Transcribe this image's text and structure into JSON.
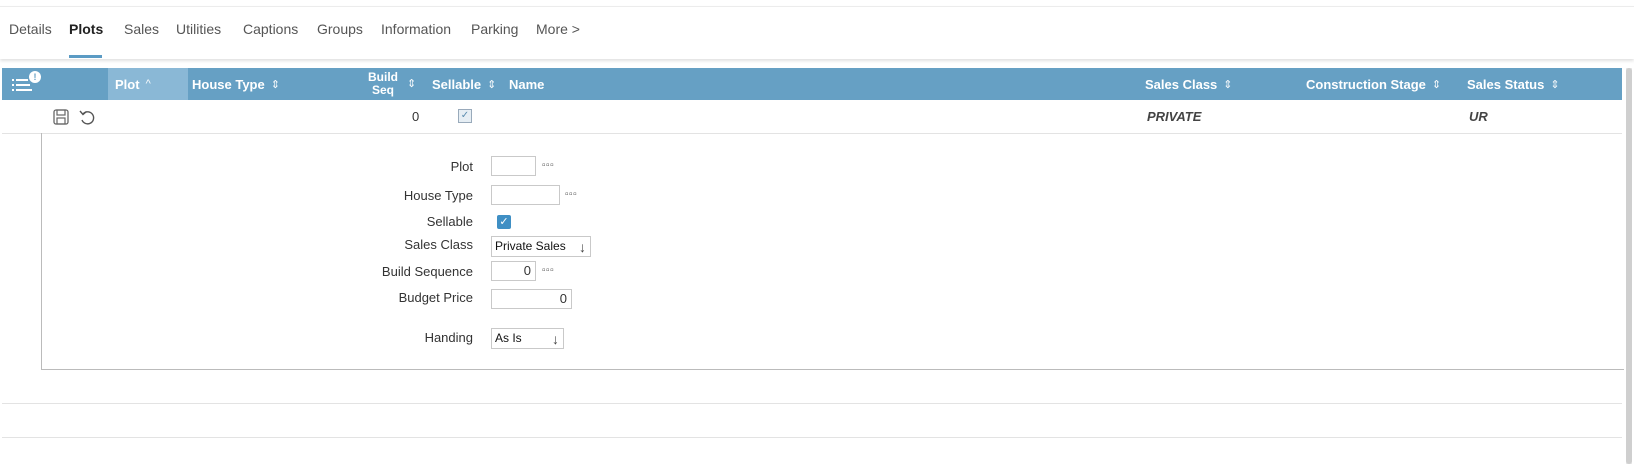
{
  "tabs": [
    "Details",
    "Plots",
    "Sales",
    "Utilities",
    "Captions",
    "Groups",
    "Information",
    "Parking",
    "More >"
  ],
  "active_tab": "Plots",
  "grid": {
    "badge": "!",
    "columns": {
      "plot": "Plot",
      "house_type": "House Type",
      "build_seq_line1": "Build",
      "build_seq_line2": "Seq",
      "sellable": "Sellable",
      "name": "Name",
      "sales_class": "Sales Class",
      "construction_stage": "Construction Stage",
      "sales_status": "Sales Status"
    },
    "row": {
      "build_seq": "0",
      "sellable": true,
      "sales_class": "PRIVATE",
      "sales_status": "UR"
    }
  },
  "form": {
    "plot_label": "Plot",
    "plot_value": "",
    "house_type_label": "House Type",
    "house_type_value": "",
    "sellable_label": "Sellable",
    "sellable_checked": true,
    "sales_class_label": "Sales Class",
    "sales_class_value": "Private Sales",
    "build_sequence_label": "Build Sequence",
    "build_sequence_value": "0",
    "budget_price_label": "Budget Price",
    "budget_price_value": "0",
    "handing_label": "Handing",
    "handing_value": "As Is"
  },
  "colors": {
    "header_bg": "#66a0c4",
    "sorted_header_bg": "#8ab8d6",
    "checkbox_blue": "#3f8fc4"
  }
}
